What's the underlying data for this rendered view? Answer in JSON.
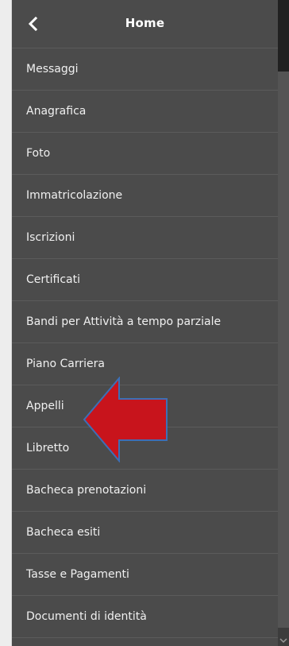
{
  "header": {
    "title": "Home"
  },
  "menu": {
    "items": [
      "Messaggi",
      "Anagrafica",
      "Foto",
      "Immatricolazione",
      "Iscrizioni",
      "Certificati",
      "Bandi per Attività a tempo parziale",
      "Piano Carriera",
      "Appelli",
      "Libretto",
      "Bacheca prenotazioni",
      "Bacheca esiti",
      "Tasse e Pagamenti",
      "Documenti di identità"
    ]
  },
  "annotation": {
    "icon": "red-arrow-left-icon",
    "fill_color": "#c8141c",
    "stroke_color": "#3d6fb6"
  }
}
